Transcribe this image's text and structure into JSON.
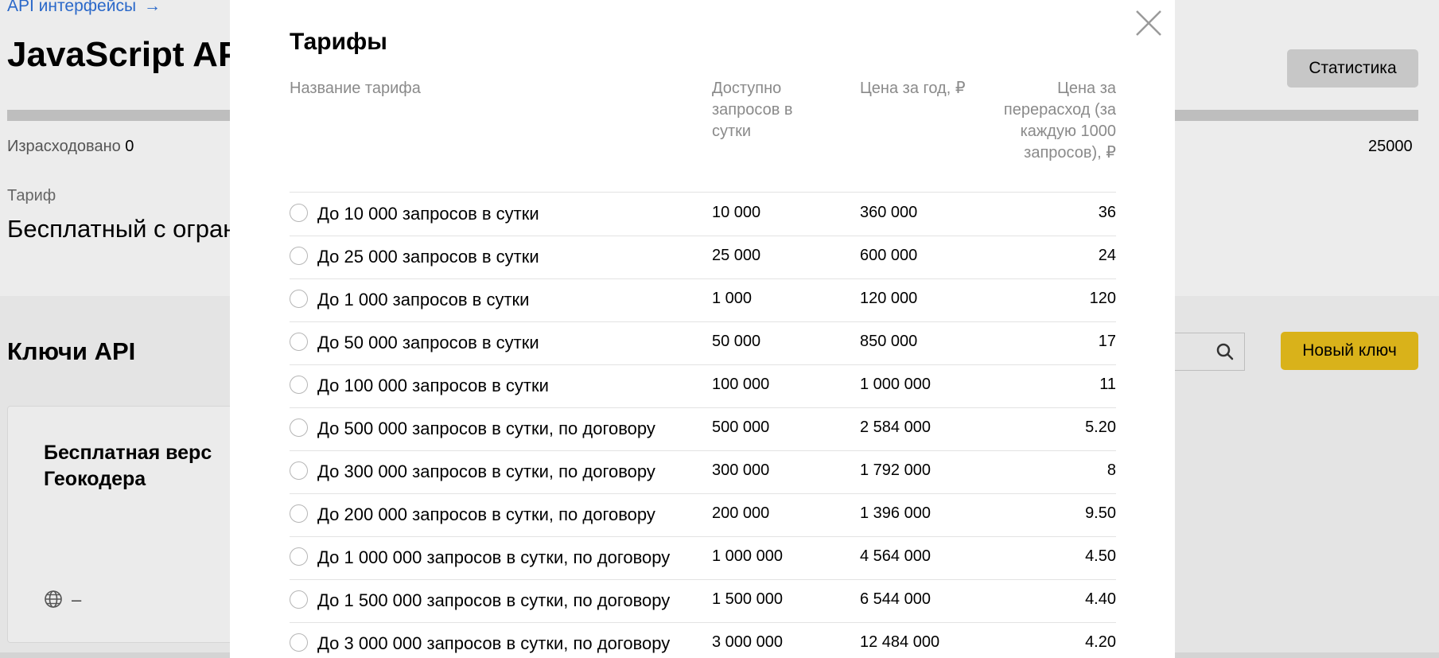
{
  "background": {
    "breadcrumb": {
      "label": "API интерфейсы",
      "arrow": "→"
    },
    "title": "JavaScript AP",
    "stats_button": "Статистика",
    "usage": {
      "label": "Израсходовано",
      "value": "0",
      "limit": "25000"
    },
    "tariff": {
      "label": "Тариф",
      "value": "Бесплатный с огран"
    },
    "keys_section": {
      "title": "Ключи API",
      "new_key_button": "Новый ключ"
    },
    "key_card": {
      "title": "Бесплатная верс Геокодера",
      "domain_value": "–"
    },
    "colors": {
      "accent_button": "#d9b21a",
      "link": "#2a68c9"
    }
  },
  "modal": {
    "title": "Тарифы",
    "columns": {
      "name": "Название тарифа",
      "available": "Доступно запросов в сутки",
      "year_price": "Цена за год, ₽",
      "overage": "Цена за перерасход (за каждую 1000 запросов), ₽"
    },
    "rows": [
      {
        "name": "До 10 000 запросов в сутки",
        "available": "10 000",
        "year_price": "360 000",
        "overage": "36"
      },
      {
        "name": "До 25 000 запросов в сутки",
        "available": "25 000",
        "year_price": "600 000",
        "overage": "24"
      },
      {
        "name": "До 1 000 запросов в сутки",
        "available": "1 000",
        "year_price": "120 000",
        "overage": "120"
      },
      {
        "name": "До 50 000 запросов в сутки",
        "available": "50 000",
        "year_price": "850 000",
        "overage": "17"
      },
      {
        "name": "До 100 000 запросов в сутки",
        "available": "100 000",
        "year_price": "1 000 000",
        "overage": "11"
      },
      {
        "name": "До 500 000 запросов в сутки, по договору",
        "available": "500 000",
        "year_price": "2 584 000",
        "overage": "5.20"
      },
      {
        "name": "До 300 000 запросов в сутки, по договору",
        "available": "300 000",
        "year_price": "1 792 000",
        "overage": "8"
      },
      {
        "name": "До 200 000 запросов в сутки, по договору",
        "available": "200 000",
        "year_price": "1 396 000",
        "overage": "9.50"
      },
      {
        "name": "До 1 000 000 запросов в сутки, по договору",
        "available": "1 000 000",
        "year_price": "4 564 000",
        "overage": "4.50"
      },
      {
        "name": "До 1 500 000 запросов в сутки, по договору",
        "available": "1 500 000",
        "year_price": "6 544 000",
        "overage": "4.40"
      },
      {
        "name": "До 3 000 000 запросов в сутки, по договору",
        "available": "3 000 000",
        "year_price": "12 484 000",
        "overage": "4.20"
      }
    ]
  }
}
